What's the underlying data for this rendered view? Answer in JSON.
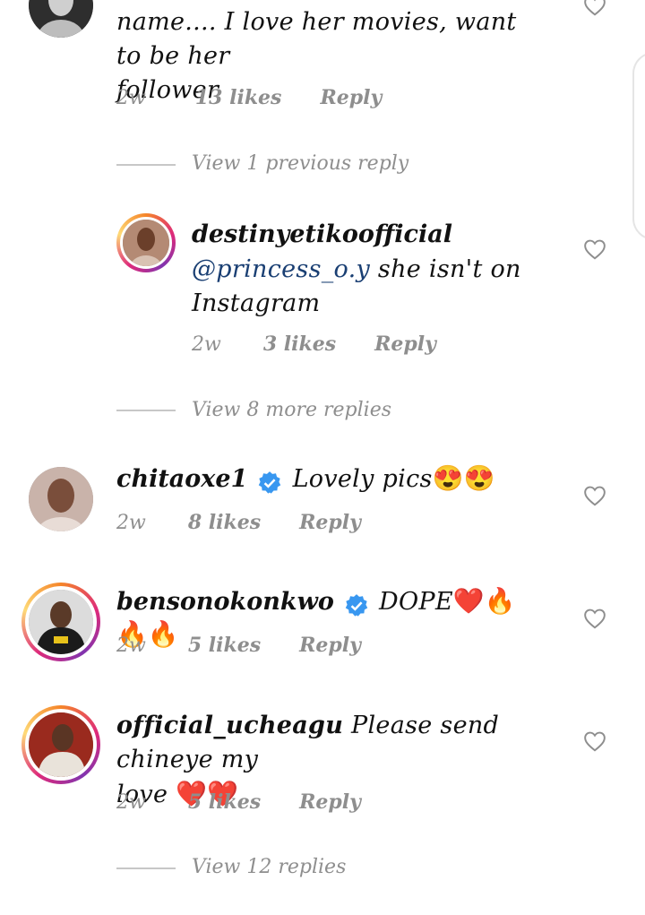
{
  "comments": [
    {
      "id": "c0",
      "text_line1": "name.... I love her movies, want to be her",
      "text_line2": "follower",
      "time": "2w",
      "likes": "13 likes",
      "reply": "Reply"
    },
    {
      "id": "r1",
      "username": "destinyetikoofficial",
      "mention": "@princess_o.y",
      "text_line1": " she isn't on",
      "text_line2": "Instagram",
      "time": "2w",
      "likes": "3 likes",
      "reply": "Reply"
    },
    {
      "id": "c2",
      "username": "chitaoxe1",
      "text": "Lovely pics",
      "emojis": "😍😍",
      "time": "2w",
      "likes": "8 likes",
      "reply": "Reply"
    },
    {
      "id": "c3",
      "username": "bensonokonkwo",
      "text": "DOPE",
      "emojis": "❤️🔥🔥🔥",
      "time": "2w",
      "likes": "5 likes",
      "reply": "Reply"
    },
    {
      "id": "c4",
      "username": "official_ucheagu",
      "text_line1": "Please send chineye my",
      "text_line2": "love ",
      "emojis": "❤️❤️",
      "time": "2w",
      "likes": "5 likes",
      "reply": "Reply"
    }
  ],
  "view_previous": "View 1 previous reply",
  "view_more_8": "View 8 more replies",
  "view_more_12": "View 12 replies",
  "colors": {
    "meta": "#8e8e8e",
    "mention": "#1a3f73",
    "verified": "#3897f0"
  },
  "icons": [
    "heart-icon",
    "verified-badge-icon"
  ]
}
